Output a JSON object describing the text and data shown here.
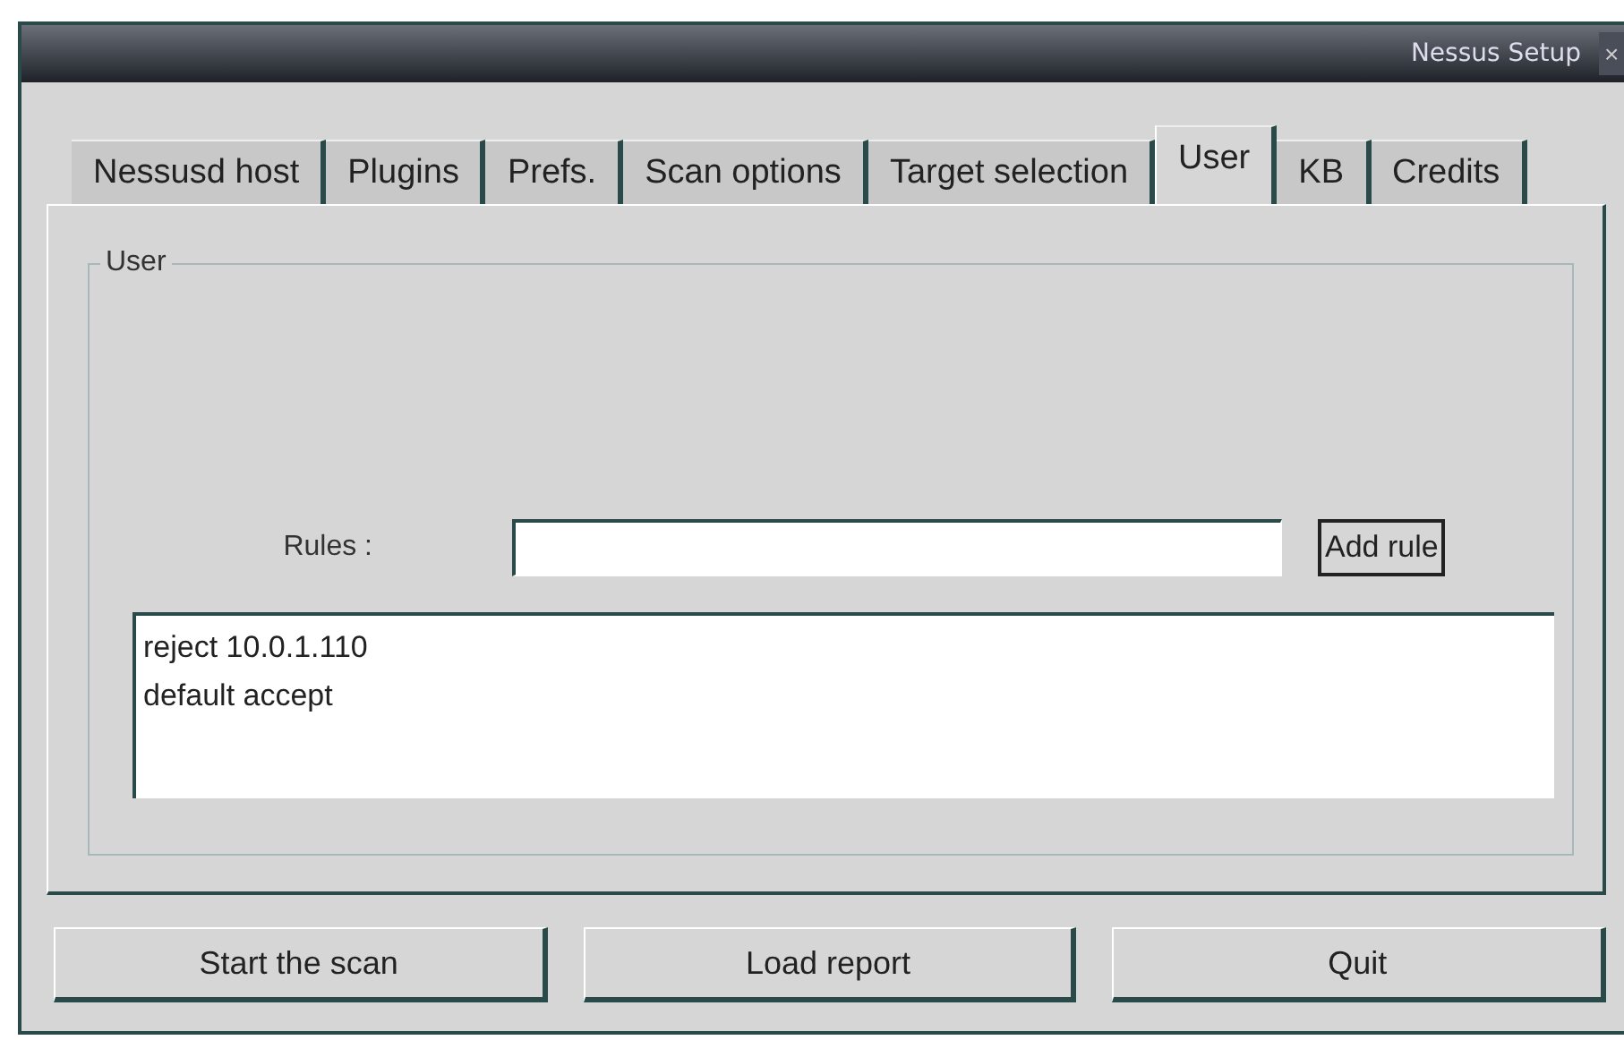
{
  "window": {
    "title": "Nessus Setup",
    "close": "×"
  },
  "tabs": [
    {
      "label": "Nessusd host",
      "selected": false
    },
    {
      "label": "Plugins",
      "selected": false
    },
    {
      "label": "Prefs.",
      "selected": false
    },
    {
      "label": "Scan options",
      "selected": false
    },
    {
      "label": "Target selection",
      "selected": false
    },
    {
      "label": "User",
      "selected": true
    },
    {
      "label": "KB",
      "selected": false
    },
    {
      "label": "Credits",
      "selected": false
    }
  ],
  "group": {
    "title": "User",
    "rules_label": "Rules :",
    "add_button": "Add rule",
    "rules_list": [
      "reject 10.0.1.110",
      "default accept"
    ]
  },
  "buttons": [
    "Start the scan",
    "Load report",
    "Quit"
  ]
}
